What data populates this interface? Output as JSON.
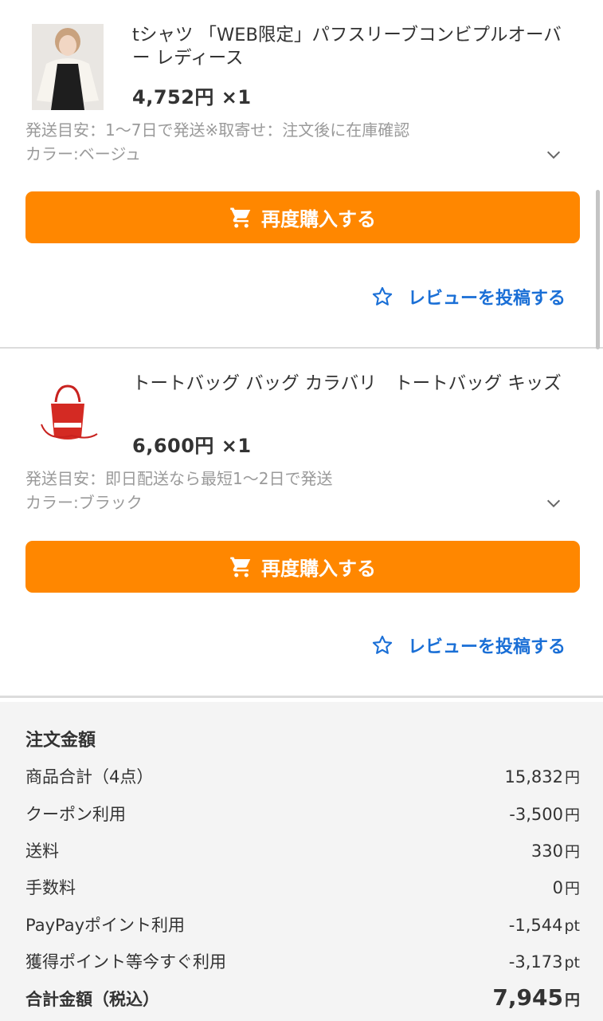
{
  "items": [
    {
      "title": "tシャツ 「WEB限定」パフスリーブコンビプルオーバー レディース",
      "price": "4,752円 ×1",
      "shipping": "発送目安：1〜7日で発送※取寄せ：注文後に在庫確認",
      "color": "カラー:ベージュ",
      "rebuy_label": "再度購入する",
      "review_label": "レビューを投稿する"
    },
    {
      "title": "トートバッグ バッグ カラバリ　トートバッグ キッズ",
      "price": "6,600円 ×1",
      "shipping": "発送目安：即日配送なら最短1〜2日で発送",
      "color": "カラー:ブラック",
      "rebuy_label": "再度購入する",
      "review_label": "レビューを投稿する"
    }
  ],
  "summary": {
    "heading": "注文金額",
    "rows": [
      {
        "label": "商品合計（4点）",
        "value": "15,832",
        "unit": "円"
      },
      {
        "label": "クーポン利用",
        "value": "-3,500",
        "unit": "円"
      },
      {
        "label": "送料",
        "value": "330",
        "unit": "円"
      },
      {
        "label": "手数料",
        "value": "0",
        "unit": "円"
      },
      {
        "label": "PayPayポイント利用",
        "value": "-1,544",
        "unit": "pt"
      },
      {
        "label": "獲得ポイント等今すぐ利用",
        "value": "-3,173",
        "unit": "pt"
      }
    ],
    "total": {
      "label": "合計金額（税込）",
      "value": "7,945",
      "unit": "円"
    }
  },
  "colors": {
    "accent": "#ff8700",
    "link": "#1a6fd6",
    "summary_bg": "#f4f4f4"
  },
  "icons": [
    "cart-icon",
    "star-outline-icon",
    "chevron-down-icon"
  ]
}
